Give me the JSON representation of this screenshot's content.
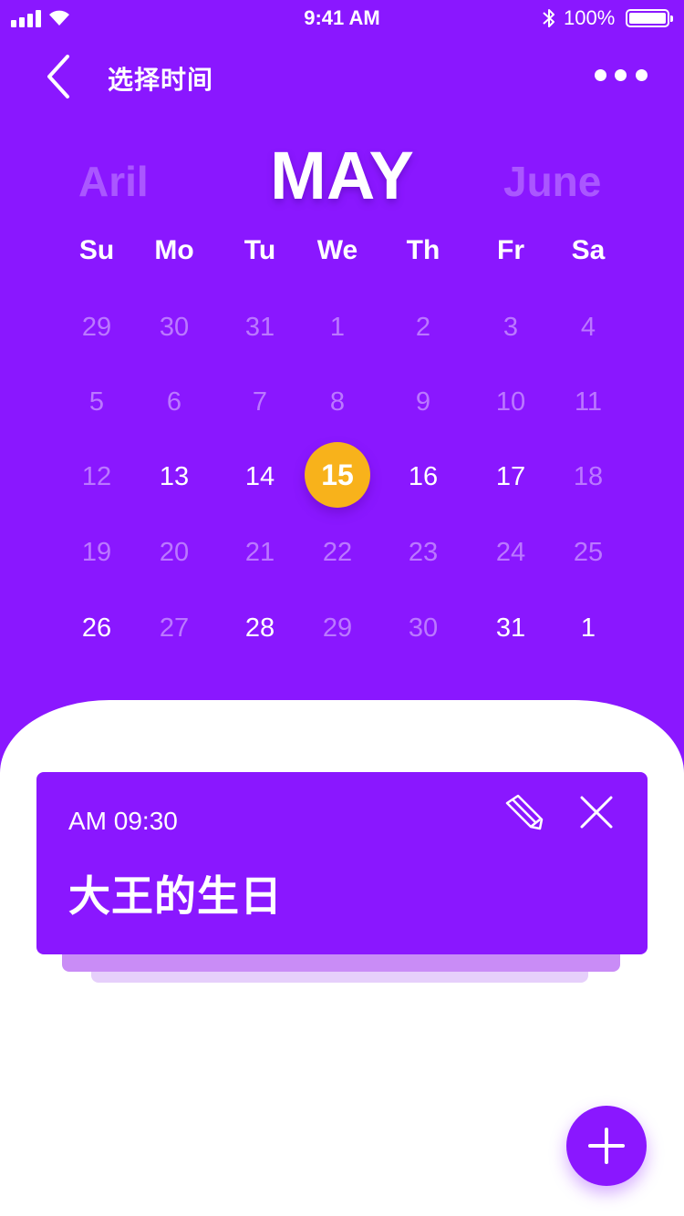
{
  "status_bar": {
    "time": "9:41 AM",
    "battery": "100%"
  },
  "header": {
    "title": "选择时间"
  },
  "months": {
    "prev": "Aril",
    "current": "MAY",
    "next": "June"
  },
  "weekdays": [
    "Su",
    "Mo",
    "Tu",
    "We",
    "Th",
    "Fr",
    "Sa"
  ],
  "weeks": [
    [
      {
        "d": "29",
        "s": "dim"
      },
      {
        "d": "30",
        "s": "dim"
      },
      {
        "d": "31",
        "s": "dim"
      },
      {
        "d": "1",
        "s": "dim"
      },
      {
        "d": "2",
        "s": "dim"
      },
      {
        "d": "3",
        "s": "dim"
      },
      {
        "d": "4",
        "s": "dim"
      }
    ],
    [
      {
        "d": "5",
        "s": "dim"
      },
      {
        "d": "6",
        "s": "dim"
      },
      {
        "d": "7",
        "s": "dim"
      },
      {
        "d": "8",
        "s": "dim"
      },
      {
        "d": "9",
        "s": "dim"
      },
      {
        "d": "10",
        "s": "dim"
      },
      {
        "d": "11",
        "s": "dim"
      }
    ],
    [
      {
        "d": "12",
        "s": "dim"
      },
      {
        "d": "13",
        "s": "bright"
      },
      {
        "d": "14",
        "s": "bright"
      },
      {
        "d": "15",
        "s": "selected"
      },
      {
        "d": "16",
        "s": "bright"
      },
      {
        "d": "17",
        "s": "bright"
      },
      {
        "d": "18",
        "s": "dim"
      }
    ],
    [
      {
        "d": "19",
        "s": "dim"
      },
      {
        "d": "20",
        "s": "dim"
      },
      {
        "d": "21",
        "s": "dim"
      },
      {
        "d": "22",
        "s": "dim"
      },
      {
        "d": "23",
        "s": "dim"
      },
      {
        "d": "24",
        "s": "dim"
      },
      {
        "d": "25",
        "s": "dim"
      }
    ],
    [
      {
        "d": "26",
        "s": "bright"
      },
      {
        "d": "27",
        "s": "dim"
      },
      {
        "d": "28",
        "s": "bright"
      },
      {
        "d": "29",
        "s": "dim"
      },
      {
        "d": "30",
        "s": "dim"
      },
      {
        "d": "31",
        "s": "bright"
      },
      {
        "d": "1",
        "s": "bright"
      }
    ]
  ],
  "event": {
    "time": "AM 09:30",
    "title": "大王的生日"
  },
  "colors": {
    "primary": "#8a17ff",
    "selected": "#f8b21b",
    "stack_1": "#c98cf6",
    "stack_2": "#e6cffb"
  },
  "icons": {
    "back": "chevron-left-icon",
    "more": "more-dots-icon",
    "edit": "pencil-icon",
    "close": "close-icon",
    "add": "plus-icon"
  }
}
